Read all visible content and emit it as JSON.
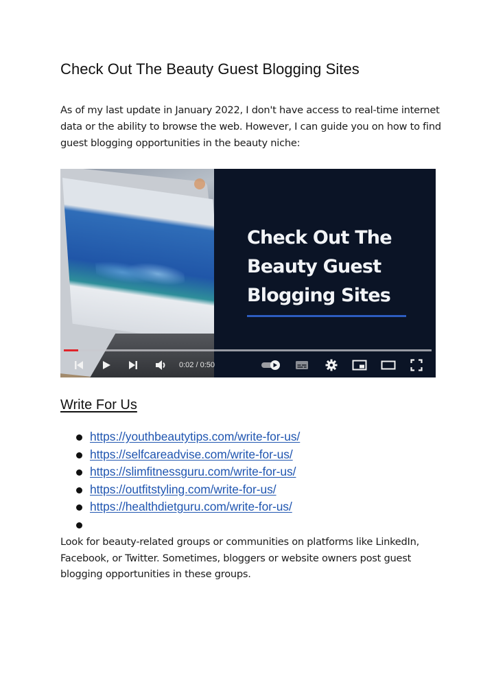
{
  "document": {
    "title": "Check Out The Beauty Guest Blogging Sites",
    "intro": "As of my last update in January 2022, I don't have access to real-time internet data or the ability to browse the web. However, I can guide you on how to find guest blogging opportunities in the beauty niche:"
  },
  "video": {
    "thumbnail_title_lines": [
      "Check Out The",
      "Beauty Guest",
      "Blogging Sites"
    ],
    "time_display": "0:02 / 0:50",
    "progress": 0.04,
    "colors": {
      "panel_bg": "#0b1426",
      "accent_underline": "#2d5cc0",
      "progress_red": "#e0242a"
    },
    "controls": [
      {
        "icon": "skip-previous-icon",
        "label": "Previous"
      },
      {
        "icon": "play-icon",
        "label": "Play"
      },
      {
        "icon": "skip-next-icon",
        "label": "Next"
      },
      {
        "icon": "volume-icon",
        "label": "Mute"
      },
      {
        "icon": "autoplay-toggle-icon",
        "label": "Autoplay"
      },
      {
        "icon": "subtitles-icon",
        "label": "Subtitles/closed captions"
      },
      {
        "icon": "settings-gear-icon",
        "label": "Settings"
      },
      {
        "icon": "miniplayer-icon",
        "label": "Miniplayer"
      },
      {
        "icon": "theater-mode-icon",
        "label": "Theater mode"
      },
      {
        "icon": "fullscreen-icon",
        "label": "Full screen"
      }
    ]
  },
  "write_for_us": {
    "heading": "Write For Us",
    "links": [
      "https://youthbeautytips.com/write-for-us/",
      "https://selfcareadvise.com/write-for-us/",
      "https://slimfitnessguru.com/write-for-us/",
      "https://outfitstyling.com/write-for-us/",
      "https://healthdietguru.com/write-for-us/",
      ""
    ],
    "link_color": "#1f55b0"
  },
  "outro": "Look for beauty-related groups or communities on platforms like LinkedIn, Facebook, or Twitter. Sometimes, bloggers or website owners post guest blogging opportunities in these groups."
}
